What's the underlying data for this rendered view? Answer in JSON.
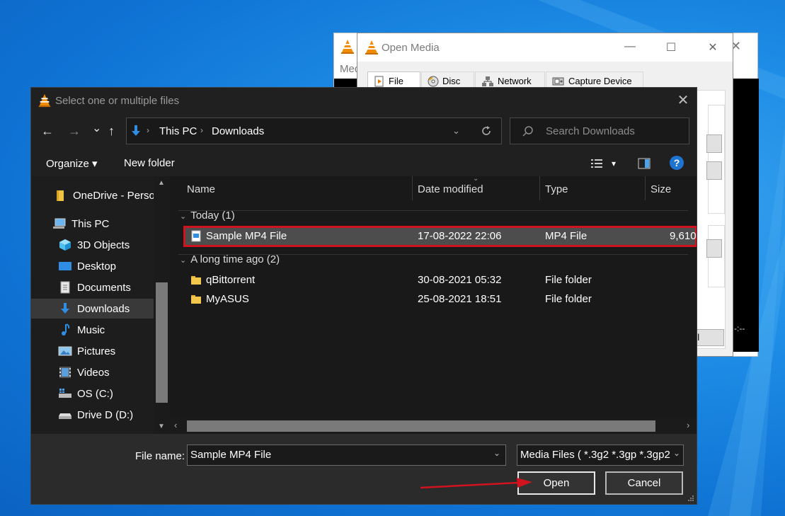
{
  "vlc_back": {
    "menu_label": "Med",
    "time_label": "-:--",
    "close_glyph": "✕"
  },
  "open_media": {
    "title": "Open Media",
    "min_glyph": "—",
    "max_glyph": "☐",
    "close_glyph": "✕",
    "tabs": [
      {
        "label": "File",
        "icon": "file-play-icon"
      },
      {
        "label": "Disc",
        "icon": "disc-icon"
      },
      {
        "label": "Network",
        "icon": "network-icon"
      },
      {
        "label": "Capture Device",
        "icon": "capture-device-icon"
      }
    ],
    "cancel_fragment": "el"
  },
  "dialog": {
    "title": "Select one or multiple files",
    "close_glyph": "✕",
    "nav": {
      "back": "←",
      "forward": "→",
      "recent": "⌄",
      "up": "↑"
    },
    "breadcrumb": [
      "This PC",
      "Downloads"
    ],
    "search_placeholder": "Search Downloads",
    "toolbar": {
      "organize": "Organize ▾",
      "new_folder": "New folder",
      "view_dropdown": "▾",
      "help": "?"
    },
    "sidebar": [
      {
        "label": "OneDrive - Person",
        "icon": "onedrive-folder-icon"
      },
      {
        "label": "This PC",
        "icon": "this-pc-icon"
      },
      {
        "label": "3D Objects",
        "icon": "3d-objects-icon"
      },
      {
        "label": "Desktop",
        "icon": "desktop-icon"
      },
      {
        "label": "Documents",
        "icon": "documents-icon"
      },
      {
        "label": "Downloads",
        "icon": "downloads-icon",
        "selected": true
      },
      {
        "label": "Music",
        "icon": "music-icon"
      },
      {
        "label": "Pictures",
        "icon": "pictures-icon"
      },
      {
        "label": "Videos",
        "icon": "videos-icon"
      },
      {
        "label": "OS (C:)",
        "icon": "os-drive-icon"
      },
      {
        "label": "Drive D (D:)",
        "icon": "drive-d-icon"
      }
    ],
    "columns": [
      "Name",
      "Date modified",
      "Type",
      "Size"
    ],
    "groups": [
      {
        "label": "Today (1)",
        "files": [
          {
            "name": "Sample MP4 File",
            "date": "17-08-2022 22:06",
            "type": "MP4 File",
            "size": "9,610",
            "icon": "mp4-file-icon",
            "selected": true
          }
        ]
      },
      {
        "label": "A long time ago (2)",
        "files": [
          {
            "name": "qBittorrent",
            "date": "30-08-2021 05:32",
            "type": "File folder",
            "size": "",
            "icon": "folder-icon"
          },
          {
            "name": "MyASUS",
            "date": "25-08-2021 18:51",
            "type": "File folder",
            "size": "",
            "icon": "folder-icon"
          }
        ]
      }
    ],
    "filename_label": "File name:",
    "filename_value": "Sample MP4 File",
    "filetype_value": "Media Files ( *.3g2 *.3gp *.3gp2",
    "open_label": "Open",
    "cancel_label": "Cancel"
  },
  "colors": {
    "selection_outline": "#d0131f",
    "dialog_bg": "#202020",
    "desktop_blue": "#1e8de6",
    "vlc_orange": "#f08c00"
  }
}
